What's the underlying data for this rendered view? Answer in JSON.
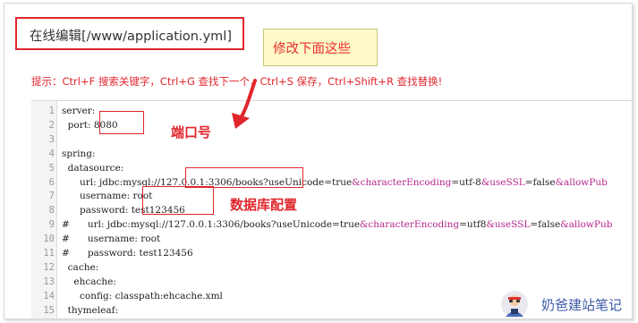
{
  "editor_title": "在线编辑[/www/application.yml]",
  "annotation_note": "修改下面这些",
  "hint": "提示：Ctrl+F 搜索关键字，Ctrl+G 查找下一个，Ctrl+S 保存，Ctrl+Shift+R 查找替换!",
  "labels": {
    "port_label": "端口号",
    "db_label": "数据库配置"
  },
  "brand_name": "奶爸建站笔记",
  "lines": [
    {
      "n": "1",
      "segs": [
        {
          "t": "server:"
        }
      ]
    },
    {
      "n": "2",
      "segs": [
        {
          "t": "  port: 8080"
        }
      ]
    },
    {
      "n": "3",
      "segs": [
        {
          "t": ""
        }
      ]
    },
    {
      "n": "4",
      "segs": [
        {
          "t": "spring:"
        }
      ]
    },
    {
      "n": "5",
      "segs": [
        {
          "t": "  datasource:"
        }
      ]
    },
    {
      "n": "6",
      "segs": [
        {
          "t": "      url: jdbc:mysql://127.0.0.1:3306/books?useUnicode=true"
        },
        {
          "t": "&characterEncoding",
          "c": "amp"
        },
        {
          "t": "=utf-8"
        },
        {
          "t": "&useSSL",
          "c": "amp"
        },
        {
          "t": "=false"
        },
        {
          "t": "&allowPub",
          "c": "amp"
        }
      ]
    },
    {
      "n": "7",
      "segs": [
        {
          "t": "      username: root"
        }
      ]
    },
    {
      "n": "8",
      "segs": [
        {
          "t": "      password: test123456"
        }
      ]
    },
    {
      "n": "9",
      "segs": [
        {
          "t": "#      url: jdbc:mysql://127.0.0.1:3306/books?useUnicode=true"
        },
        {
          "t": "&characterEncoding",
          "c": "amp"
        },
        {
          "t": "=utf8"
        },
        {
          "t": "&useSSL",
          "c": "amp"
        },
        {
          "t": "=false"
        },
        {
          "t": "&allowPub",
          "c": "amp"
        }
      ]
    },
    {
      "n": "10",
      "segs": [
        {
          "t": "#      username: root"
        }
      ]
    },
    {
      "n": "11",
      "segs": [
        {
          "t": "#      password: test123456"
        }
      ]
    },
    {
      "n": "12",
      "segs": [
        {
          "t": "  cache:"
        }
      ]
    },
    {
      "n": "13",
      "segs": [
        {
          "t": "    ehcache:"
        }
      ]
    },
    {
      "n": "14",
      "segs": [
        {
          "t": "      config: classpath:ehcache.xml"
        }
      ]
    },
    {
      "n": "15",
      "segs": [
        {
          "t": "  thymeleaf:"
        }
      ]
    }
  ],
  "colors": {
    "accent_red": "#e0262c",
    "note_bg": "#fef9c8",
    "ampersand": "#b5268c",
    "brand_blue": "#3d5aa8"
  }
}
